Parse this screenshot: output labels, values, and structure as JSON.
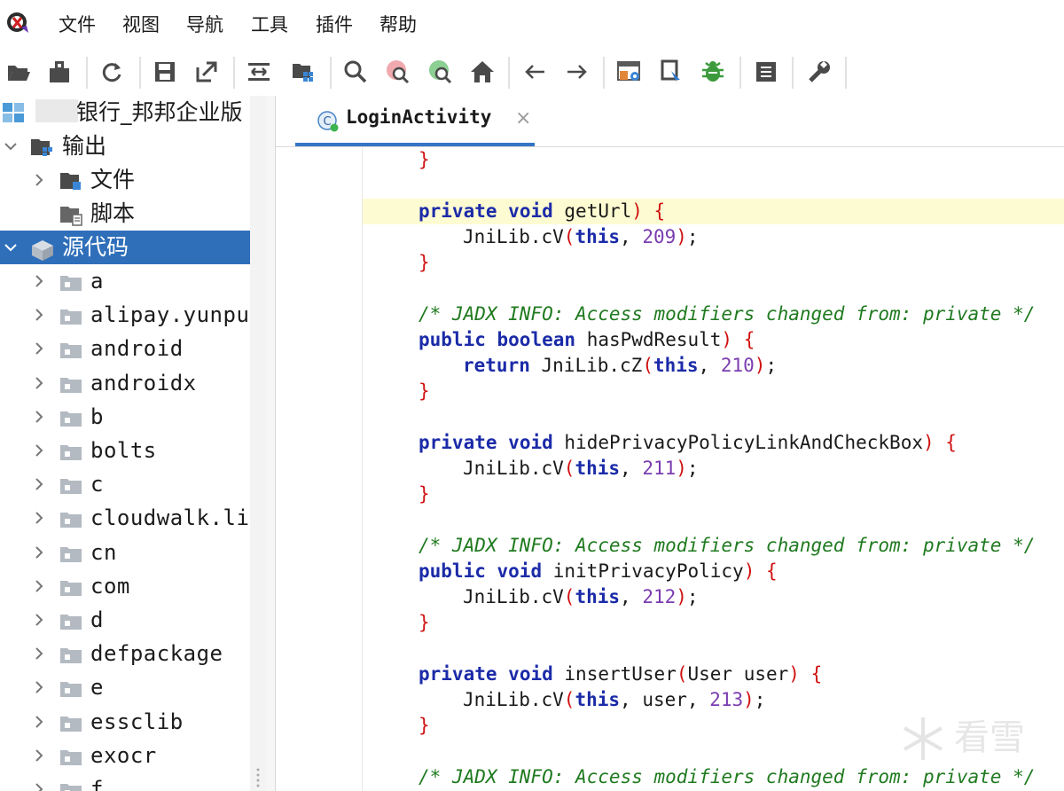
{
  "menu": [
    "文件",
    "视图",
    "导航",
    "工具",
    "插件",
    "帮助"
  ],
  "toolbar": {
    "icons": [
      "open-folder",
      "export",
      "refresh",
      "save",
      "export-out",
      "fit-view",
      "project-tree",
      "search",
      "search-class",
      "search-usage",
      "home",
      "back",
      "forward",
      "deobfuscation",
      "quark",
      "debug",
      "log",
      "preferences"
    ]
  },
  "tree": {
    "root": "银行_邦邦企业版",
    "output": "输出",
    "file": "文件",
    "script": "脚本",
    "sources": "源代码",
    "packages": [
      "a",
      "alipay.yunpu",
      "android",
      "androidx",
      "b",
      "bolts",
      "c",
      "cloudwalk.li",
      "cn",
      "com",
      "d",
      "defpackage",
      "e",
      "essclib",
      "exocr",
      "f"
    ]
  },
  "tab": {
    "title": "LoginActivity",
    "close": "×"
  },
  "code": {
    "closing_brace": "}",
    "private": "private",
    "public": "public",
    "void": "void",
    "boolean": "boolean",
    "return": "return",
    "this": "this",
    "open_paren": "(",
    "close_paren_brace": ") {",
    "close_paren": ")",
    "open_brace": "{",
    "comment": "/* JADX INFO: Access modifiers changed from: private */",
    "jni_cv": "JniLib.cV",
    "jni_cz": "JniLib.cZ",
    "sep": ", ",
    "end": ";",
    "user_arg": "user",
    "methods": {
      "getUrl": "getUrl",
      "hasPwdResult": "hasPwdResult",
      "hide": "hidePrivacyPolicyLinkAndCheckBox",
      "init": "initPrivacyPolicy",
      "insert": "insertUser",
      "insert_param": "User user"
    },
    "nums": [
      "209",
      "210",
      "211",
      "212",
      "213"
    ]
  },
  "watermark": "看雪"
}
